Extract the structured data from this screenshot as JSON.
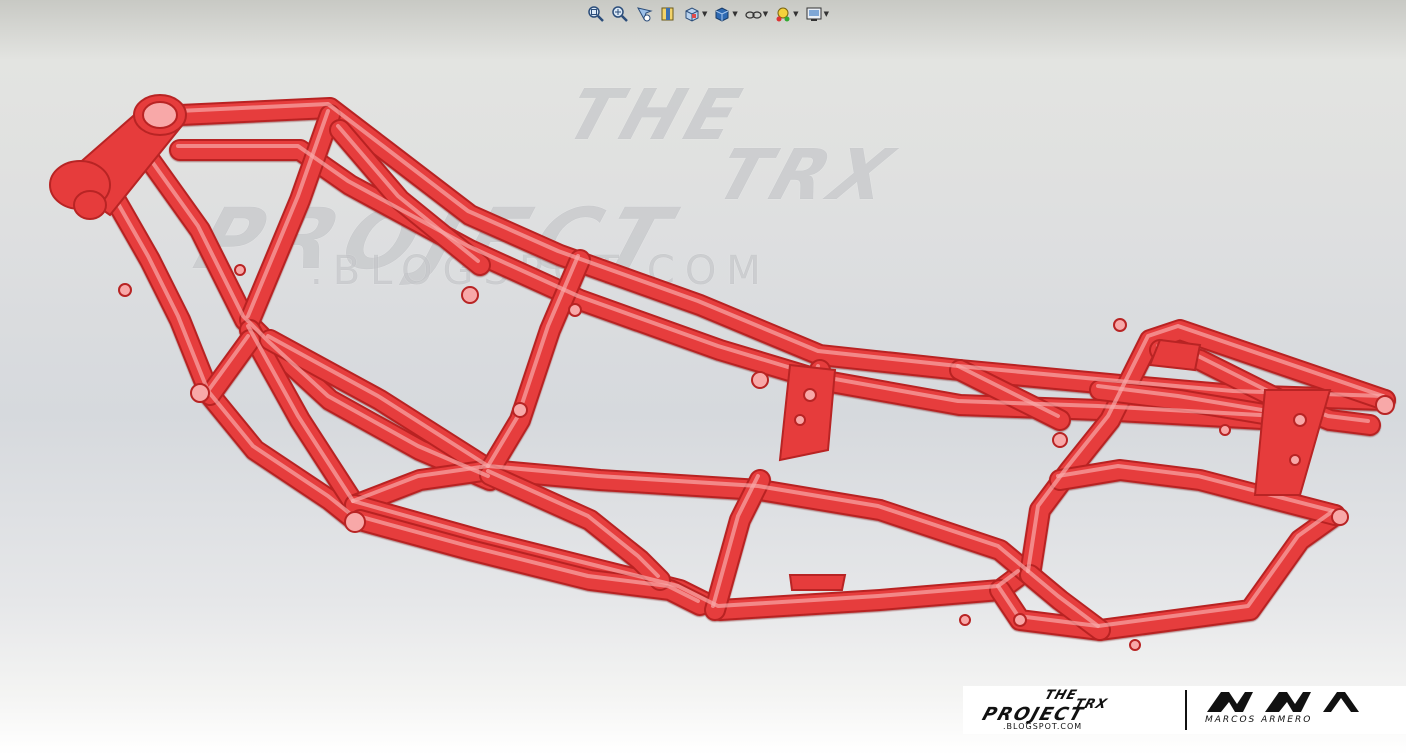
{
  "toolbar": {
    "buttons": [
      {
        "icon": "zoom-to-fit-icon"
      },
      {
        "icon": "zoom-to-area-icon"
      },
      {
        "icon": "previous-view-icon"
      },
      {
        "icon": "section-view-icon"
      },
      {
        "icon": "view-orientation-icon"
      },
      {
        "icon": "display-style-icon"
      },
      {
        "icon": "hide-show-items-icon"
      },
      {
        "icon": "edit-appearance-icon"
      },
      {
        "icon": "apply-scene-icon"
      }
    ]
  },
  "watermark": {
    "line1": "THE",
    "line2": "TRX",
    "line3": "PROJECT",
    "line4": ".BLOGSPOT.COM"
  },
  "logo": {
    "line1": "THE",
    "line2": "TRX",
    "line3": "PROJECT",
    "line4": ".BLOGSPOT.COM",
    "author": "MARCOS ARMERO"
  },
  "colors": {
    "frame": "#e63c3c",
    "frame_dark": "#b82424",
    "frame_light": "#f8a8a8",
    "background_top": "#c8c9c4",
    "background_bottom": "#ffffff"
  }
}
